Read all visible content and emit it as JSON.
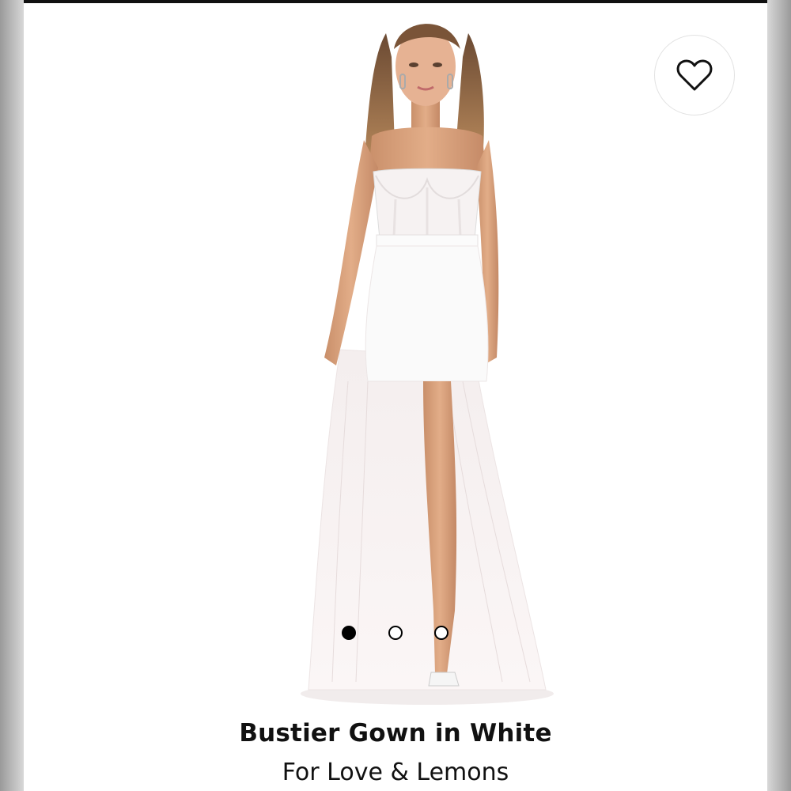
{
  "product": {
    "title": "Bustier Gown in White",
    "brand": "For Love & Lemons",
    "image_description_icon": "dress-photo"
  },
  "favorite": {
    "icon": "heart-outline-icon",
    "active": false
  },
  "carousel": {
    "total": 3,
    "current": 1
  },
  "colors": {
    "background": "#ffffff",
    "text": "#111111",
    "dot_active": "#000000",
    "side_gutter": "#d8d8d8"
  }
}
